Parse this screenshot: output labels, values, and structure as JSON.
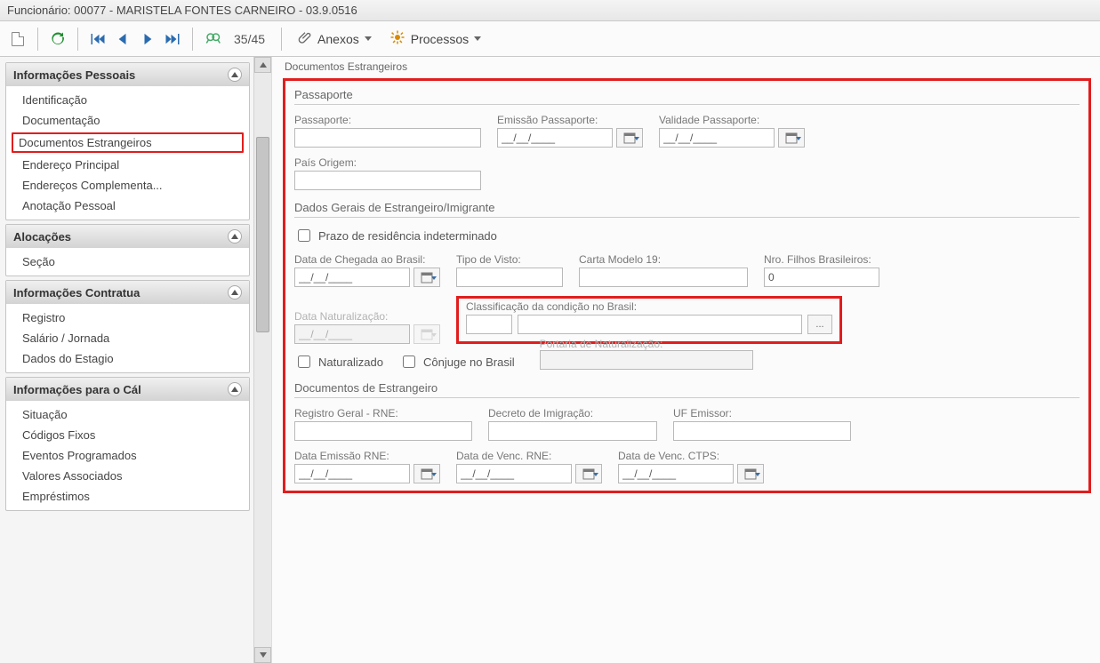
{
  "window_title": "Funcionário: 00077 - MARISTELA FONTES CARNEIRO - 03.9.0516",
  "toolbar": {
    "pager": "35/45",
    "anexos": "Anexos",
    "processos": "Processos"
  },
  "sidebar": {
    "groups": [
      {
        "title": "Informações Pessoais",
        "items": [
          {
            "label": "Identificação",
            "highlight": false
          },
          {
            "label": "Documentação",
            "highlight": false
          },
          {
            "label": "Documentos Estrangeiros",
            "highlight": true
          },
          {
            "label": "Endereço Principal",
            "highlight": false
          },
          {
            "label": "Endereços Complementa...",
            "highlight": false
          },
          {
            "label": "Anotação Pessoal",
            "highlight": false
          }
        ]
      },
      {
        "title": "Alocações",
        "items": [
          {
            "label": "Seção",
            "highlight": false
          }
        ]
      },
      {
        "title": "Informações Contratua",
        "items": [
          {
            "label": "Registro",
            "highlight": false
          },
          {
            "label": "Salário / Jornada",
            "highlight": false
          },
          {
            "label": "Dados do Estagio",
            "highlight": false
          }
        ]
      },
      {
        "title": "Informações para o Cál",
        "items": [
          {
            "label": "Situação",
            "highlight": false
          },
          {
            "label": "Códigos Fixos",
            "highlight": false
          },
          {
            "label": "Eventos Programados",
            "highlight": false
          },
          {
            "label": "Valores Associados",
            "highlight": false
          },
          {
            "label": "Empréstimos",
            "highlight": false
          }
        ]
      }
    ]
  },
  "page": {
    "title": "Documentos Estrangeiros",
    "passaporte": {
      "section_title": "Passaporte",
      "passaporte_label": "Passaporte:",
      "passaporte_value": "",
      "emissao_label": "Emissão Passaporte:",
      "emissao_value": "__/__/____",
      "validade_label": "Validade Passaporte:",
      "validade_value": "__/__/____",
      "pais_label": "País Origem:",
      "pais_value": ""
    },
    "dados_gerais": {
      "section_title": "Dados Gerais de Estrangeiro/Imigrante",
      "prazo_label": "Prazo de residência indeterminado",
      "data_chegada_label": "Data de Chegada ao Brasil:",
      "data_chegada_value": "__/__/____",
      "tipo_visto_label": "Tipo de Visto:",
      "tipo_visto_value": "",
      "carta_modelo_label": "Carta Modelo 19:",
      "carta_modelo_value": "",
      "nro_filhos_label": "Nro. Filhos Brasileiros:",
      "nro_filhos_value": "0",
      "data_nat_label": "Data Naturalização:",
      "data_nat_value": "__/__/____",
      "classificacao_label": "Classificação da condição no Brasil:",
      "classificacao_code": "",
      "classificacao_desc": "",
      "naturalizado_label": "Naturalizado",
      "conjuge_label": "Cônjuge no Brasil",
      "portaria_label": "Portaria de Naturalização:",
      "portaria_value": ""
    },
    "docs_estrangeiro": {
      "section_title": "Documentos de Estrangeiro",
      "rne_label": "Registro Geral - RNE:",
      "rne_value": "",
      "decreto_label": "Decreto de Imigração:",
      "decreto_value": "",
      "uf_label": "UF Emissor:",
      "uf_value": "",
      "data_emissao_rne_label": "Data Emissão RNE:",
      "data_emissao_rne_value": "__/__/____",
      "data_venc_rne_label": "Data de Venc. RNE:",
      "data_venc_rne_value": "__/__/____",
      "data_venc_ctps_label": "Data de Venc. CTPS:",
      "data_venc_ctps_value": "__/__/____"
    }
  },
  "icons": {
    "ellipsis": "..."
  }
}
